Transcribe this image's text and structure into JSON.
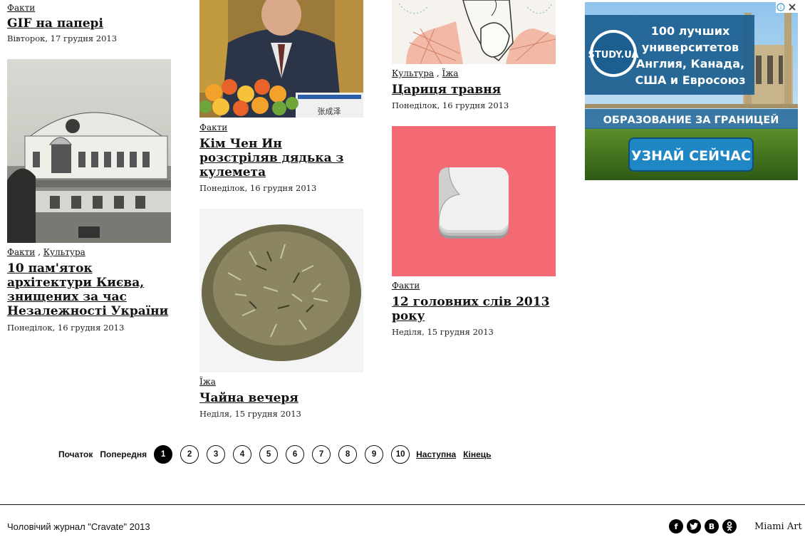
{
  "articles": {
    "a1": {
      "tag1": "Факти",
      "title": "GIF на папері",
      "date": "Вівторок, 17 грудня 2013"
    },
    "a2": {
      "tag1": "Факти",
      "tag2": "Культура",
      "title": "10 пам'яток архітектури Києва, знищених за час Незалежності України",
      "date": "Понеділок, 16 грудня 2013"
    },
    "a3": {
      "tag1": "Факти",
      "title": "Кім Чен Ин розстріляв дядька з кулемета",
      "date": "Понеділок, 16 грудня 2013",
      "caption": "张成泽"
    },
    "a4": {
      "tag1": "Їжа",
      "title": "Чайна вечеря",
      "date": "Неділя, 15 грудня 2013"
    },
    "a5": {
      "tag1": "Культура",
      "tag2": "Їжа",
      "title": "Цариця травня",
      "date": "Понеділок, 16 грудня 2013"
    },
    "a6": {
      "tag1": "Факти",
      "title": "12 головних слів 2013 року",
      "date": "Неділя, 15 грудня 2013"
    }
  },
  "pager": {
    "first": "Початок",
    "prev": "Попередня",
    "pages": [
      "1",
      "2",
      "3",
      "4",
      "5",
      "6",
      "7",
      "8",
      "9",
      "10"
    ],
    "current": "1",
    "next": "Наступна",
    "last": "Кінець"
  },
  "ad": {
    "brand": "STUDY.UA",
    "line1": "100 лучших",
    "line2": "университетов",
    "line3": "Англия, Канада,",
    "line4": "США и Евросоюз",
    "banner": "ОБРАЗОВАНИЕ ЗА ГРАНИЦЕЙ",
    "cta": "УЗНАЙ СЕЙЧАС"
  },
  "footer": {
    "copyright": "Чоловічий журнал \"Cravate\" 2013",
    "credit": "Miami Art",
    "socials": [
      "facebook-icon",
      "twitter-icon",
      "vkontakte-icon",
      "odnoklassniki-icon"
    ]
  },
  "colors": {
    "accent_pink": "#f46a74",
    "ad_blue": "#1b5e8f"
  }
}
